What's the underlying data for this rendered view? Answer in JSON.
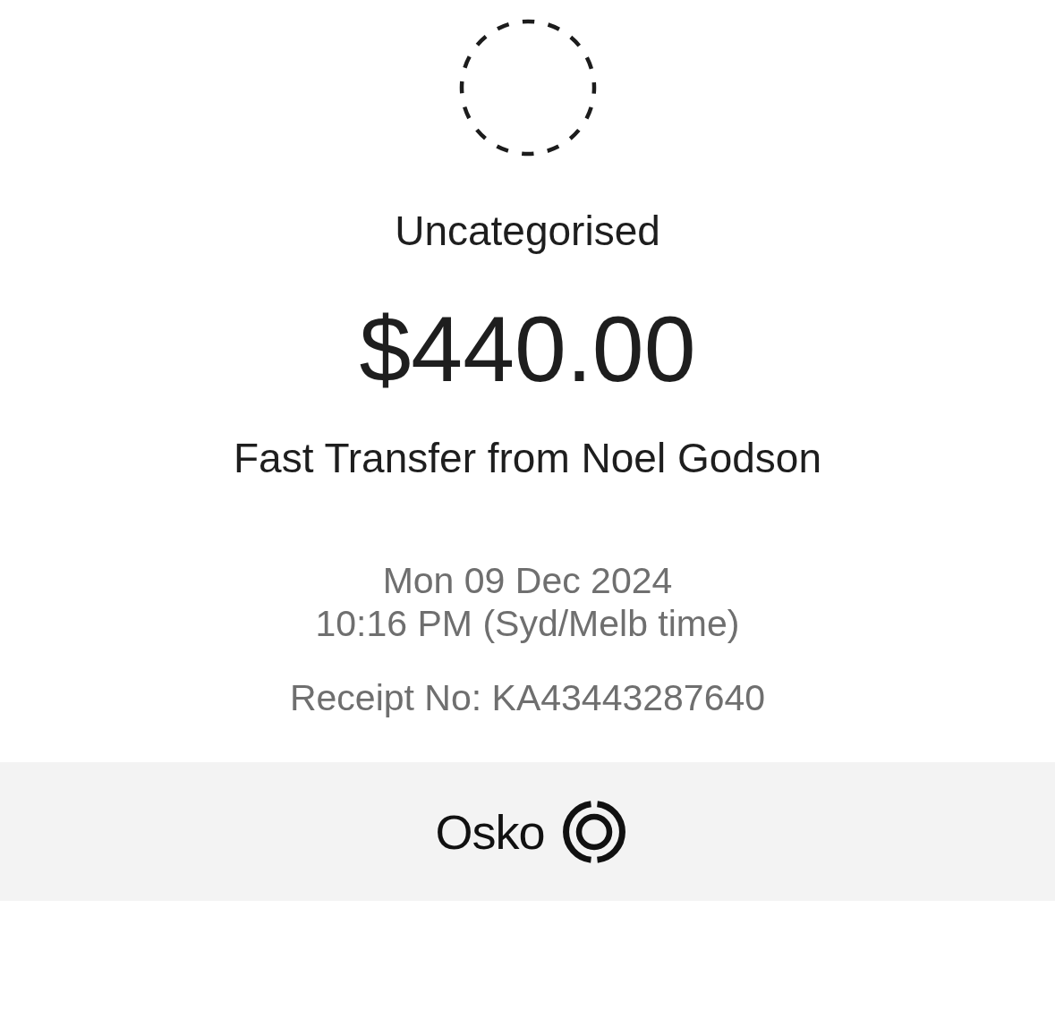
{
  "transaction": {
    "category": "Uncategorised",
    "amount": "$440.00",
    "description": "Fast Transfer from Noel Godson",
    "date": "Mon 09 Dec 2024",
    "time": "10:16 PM (Syd/Melb time)",
    "receipt": "Receipt No: KA43443287640"
  },
  "payment_network": {
    "name": "Osko"
  }
}
